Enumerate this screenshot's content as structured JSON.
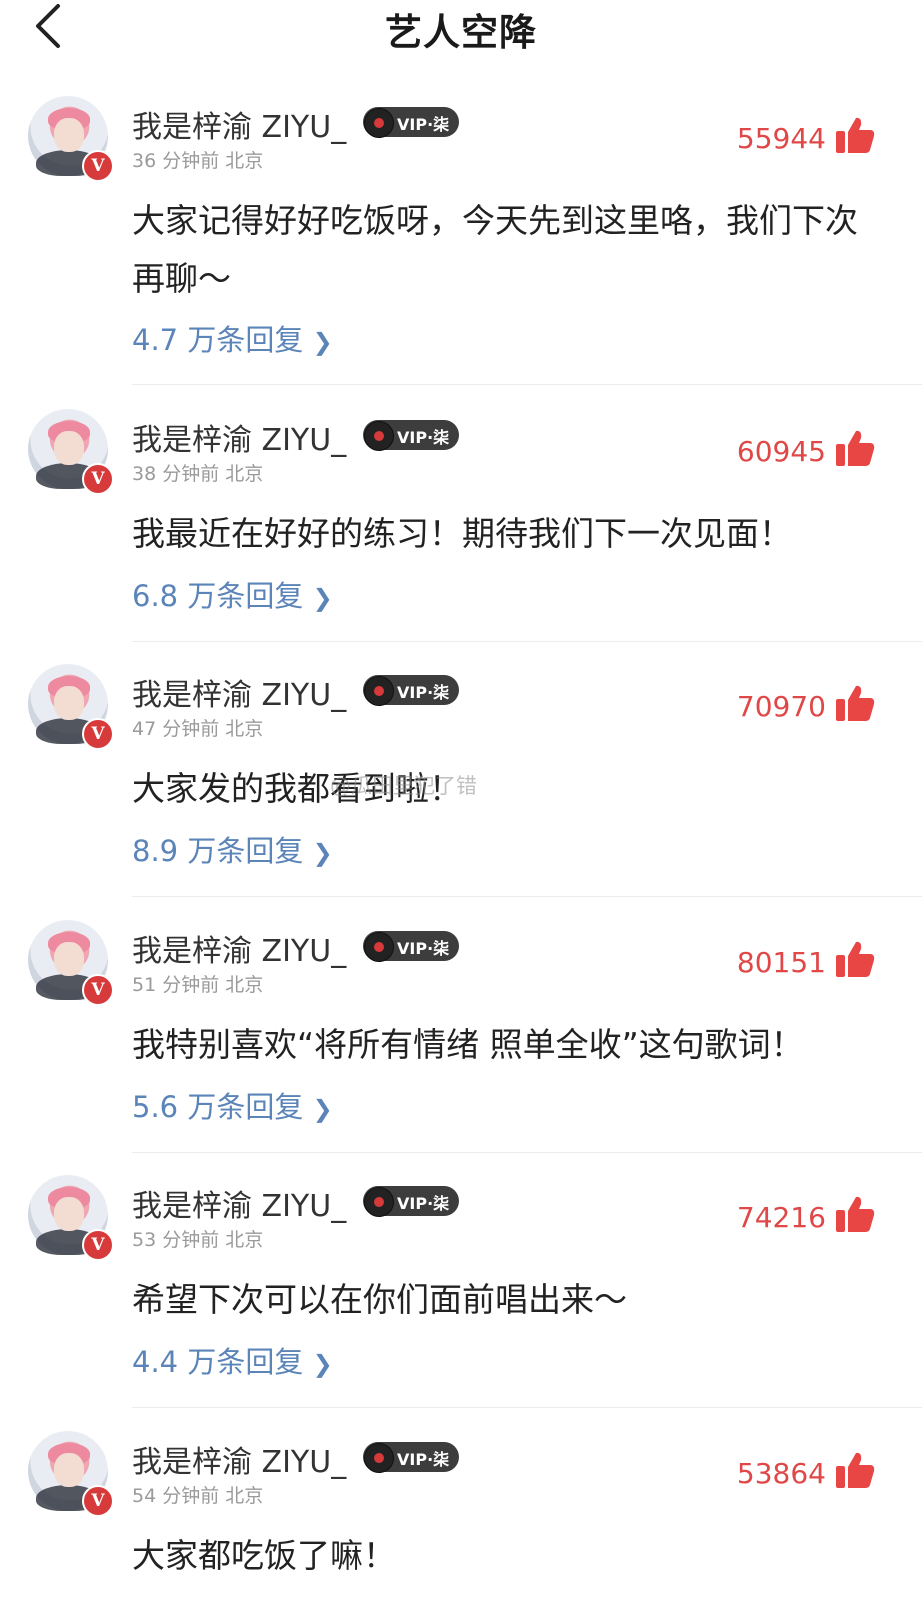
{
  "header": {
    "title": "艺人空降"
  },
  "watermark": "@瓜田里犯了错",
  "comments": [
    {
      "username": "我是梓渝 ZIYU_",
      "vip_label": "VIP·柒",
      "time": "36 分钟前",
      "location": "北京",
      "likes": "55944",
      "content": "大家记得好好吃饭呀，今天先到这里咯，我们下次再聊～",
      "replies": "4.7 万条回复"
    },
    {
      "username": "我是梓渝 ZIYU_",
      "vip_label": "VIP·柒",
      "time": "38 分钟前",
      "location": "北京",
      "likes": "60945",
      "content": "我最近在好好的练习！期待我们下一次见面！",
      "replies": "6.8 万条回复"
    },
    {
      "username": "我是梓渝 ZIYU_",
      "vip_label": "VIP·柒",
      "time": "47 分钟前",
      "location": "北京",
      "likes": "70970",
      "content": "大家发的我都看到啦！",
      "replies": "8.9 万条回复"
    },
    {
      "username": "我是梓渝 ZIYU_",
      "vip_label": "VIP·柒",
      "time": "51 分钟前",
      "location": "北京",
      "likes": "80151",
      "content": "我特别喜欢“将所有情绪 照单全收”这句歌词！",
      "replies": "5.6 万条回复"
    },
    {
      "username": "我是梓渝 ZIYU_",
      "vip_label": "VIP·柒",
      "time": "53 分钟前",
      "location": "北京",
      "likes": "74216",
      "content": "希望下次可以在你们面前唱出来～",
      "replies": "4.4 万条回复"
    },
    {
      "username": "我是梓渝 ZIYU_",
      "vip_label": "VIP·柒",
      "time": "54 分钟前",
      "location": "北京",
      "likes": "53864",
      "content": "大家都吃饭了嘛！",
      "replies": ""
    }
  ]
}
